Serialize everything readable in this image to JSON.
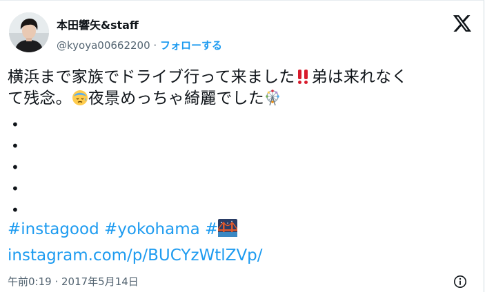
{
  "author": {
    "display_name": "本田響矢&staff",
    "handle": "@kyoya00662200",
    "separator": " · ",
    "follow_label": "フォローする"
  },
  "tweet": {
    "line1_text": "横浜まで家族でドライブ行って来ました",
    "line1_after_emoji": "弟は来れなく",
    "line2_text": "て残念。",
    "line2_after_emoji": "夜景めっちゃ綺麗でした",
    "bullets": [
      "•",
      "•",
      "•",
      "•",
      "•"
    ],
    "hashtags": [
      "#instagood",
      "#yokohama",
      "#"
    ],
    "link": "instagram.com/p/BUCYzWtlZVp/",
    "timestamp": "午前0:19 · 2017年5月14日"
  },
  "icons": {
    "x_logo": "x-logo-icon",
    "info": "info-icon",
    "emoji_1": "double-exclamation-emoji",
    "emoji_2": "disappointed-relieved-face-emoji",
    "emoji_3": "ferris-wheel-emoji",
    "emoji_4": "bridge-at-night-emoji"
  },
  "colors": {
    "link": "#1d9bf0",
    "secondary_text": "#536471",
    "primary_text": "#0f1419"
  }
}
